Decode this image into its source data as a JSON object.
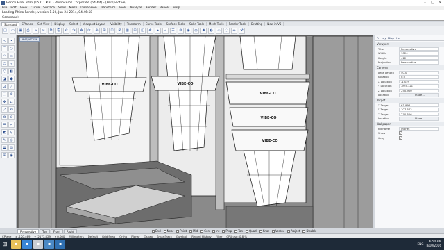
{
  "window": {
    "title": "Bench Final 3dm (15311 KB) - Rhinoceros Corporate (64-bit) - [Perspective]",
    "controls": [
      "–",
      "□",
      "✕"
    ]
  },
  "menu": [
    "File",
    "Edit",
    "View",
    "Curve",
    "Surface",
    "Solid",
    "Mesh",
    "Dimension",
    "Transform",
    "Tools",
    "Analyze",
    "Render",
    "Panels",
    "Help"
  ],
  "command": {
    "history": "Loading Rhino Render, version 1.50, Jun 24 2014, 04:46:58",
    "prompt": "Command:"
  },
  "tabs": [
    "Standard",
    "CPlanes",
    "Set View",
    "Display",
    "Select",
    "Viewport Layout",
    "Visibility",
    "Transform",
    "Curve Tools",
    "Surface Tools",
    "Solid Tools",
    "Mesh Tools",
    "Render Tools",
    "Drafting",
    "New in V5"
  ],
  "active_tab": "Standard",
  "toolbar_icons": [
    "new-icon",
    "open-icon",
    "save-icon",
    "print-icon",
    "import-icon",
    "cut-icon",
    "copy-icon",
    "paste-icon",
    "undo-icon",
    "redo-icon",
    "pan-icon",
    "rotate-icon",
    "zoom-icon",
    "zoom-window-icon",
    "zoom-extents-icon",
    "zoom-selected-icon",
    "viewport-icon",
    "four-views-icon",
    "cplane-icon",
    "grid-icon",
    "snap-icon",
    "select-icon",
    "layer-icon",
    "properties-icon",
    "render-icon",
    "material-icon",
    "light-icon",
    "shade-icon",
    "wire-icon",
    "ghost-icon",
    "xray-icon",
    "options-icon"
  ],
  "viewport": {
    "label": "Perspective",
    "background": "#8d8d8d",
    "box_label": "VIBE-CO"
  },
  "panel": {
    "tabs": [
      "Pr",
      "Lay",
      "Disp",
      "He"
    ],
    "sections": [
      {
        "title": "Viewport",
        "rows": [
          [
            "Title",
            "Perspective"
          ],
          [
            "Width",
            "1024"
          ],
          [
            "Height",
            "412"
          ],
          [
            "Projection",
            "Perspective"
          ]
        ]
      },
      {
        "title": "Camera",
        "rows": [
          [
            "Lens Length",
            "50.0"
          ],
          [
            "Rotation",
            "0.0"
          ],
          [
            "X Location",
            "-1.029"
          ],
          [
            "Y Location",
            "-925.121"
          ],
          [
            "Z Location",
            "250.900"
          ],
          [
            "Location",
            "Place..."
          ]
        ]
      },
      {
        "title": "Target",
        "rows": [
          [
            "X Target",
            "63.996"
          ],
          [
            "Y Target",
            "107.542"
          ],
          [
            "Z Target",
            "270.506"
          ],
          [
            "Location",
            "Place..."
          ]
        ]
      },
      {
        "title": "Wallpaper",
        "rows": [
          [
            "Filename",
            "(none)"
          ],
          [
            "Show",
            "✓"
          ],
          [
            "Gray",
            "✓"
          ]
        ]
      }
    ]
  },
  "viewport_tabs": [
    "Perspective",
    "Top",
    "Front",
    "Right"
  ],
  "active_viewport_tab": "Perspective",
  "osnaps": [
    "End",
    "Near",
    "Point",
    "Mid",
    "Cen",
    "Int",
    "Perp",
    "Tan",
    "Quad",
    "Knot",
    "Vertex",
    "Project",
    "Disable"
  ],
  "status": [
    "CPlane",
    "x -120.469",
    "y -2177.829",
    "z 0.000",
    "Millimeters",
    "Default",
    "Grid Snap",
    "Ortho",
    "Planar",
    "Osnap",
    "SmartTrack",
    "Gumball",
    "Record History",
    "Filter",
    "CPU use: 0.8 %"
  ],
  "taskbar": {
    "apps": [
      {
        "name": "explorer-icon",
        "color": "#e8c15a"
      },
      {
        "name": "browser-icon",
        "color": "#3a86d6"
      },
      {
        "name": "rhino-icon",
        "color": "#c9cdd3"
      },
      {
        "name": "mail-icon",
        "color": "#4a88c4"
      },
      {
        "name": "photoshop-icon",
        "color": "#2f6fb0"
      }
    ],
    "tray": "ENG",
    "time": "6:50 AM",
    "date": "8/10/2016"
  }
}
